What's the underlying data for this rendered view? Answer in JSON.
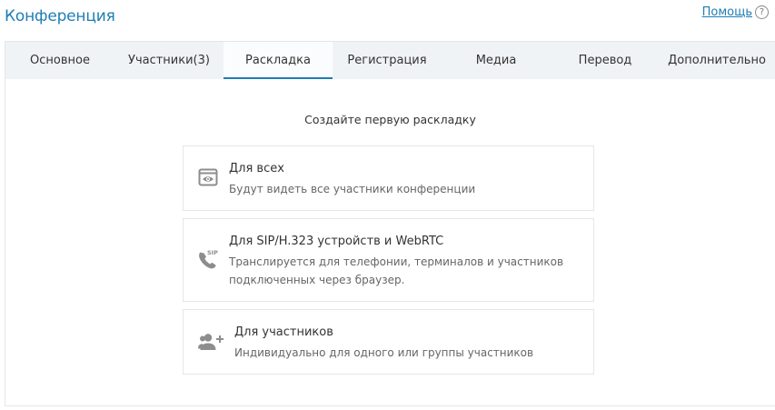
{
  "header": {
    "title": "Конференция",
    "help_label": "Помощь",
    "help_icon": "?"
  },
  "tabs": [
    {
      "label": "Основное"
    },
    {
      "label": "Участники(3)"
    },
    {
      "label": "Раскладка",
      "active": true
    },
    {
      "label": "Регистрация"
    },
    {
      "label": "Медиа"
    },
    {
      "label": "Перевод"
    },
    {
      "label": "Дополнительно"
    }
  ],
  "main": {
    "heading": "Создайте первую раскладку",
    "options": [
      {
        "title": "Для всех",
        "description": "Будут видеть все участники конференции",
        "icon": "eye-window-icon"
      },
      {
        "title": "Для SIP/H.323 устройств и WebRTC",
        "description_line1": "Транслируется для телефонии, терминалов и участников",
        "description_line2": "подключенных через браузер.",
        "icon": "sip-phone-icon"
      },
      {
        "title": "Для участников",
        "description": "Индивидуально для одного или группы участников",
        "icon": "add-participants-icon"
      }
    ]
  },
  "colors": {
    "accent": "#1e7db5",
    "tabbar_bg": "#f0f3f6",
    "icon_gray": "#8d8d8d"
  }
}
